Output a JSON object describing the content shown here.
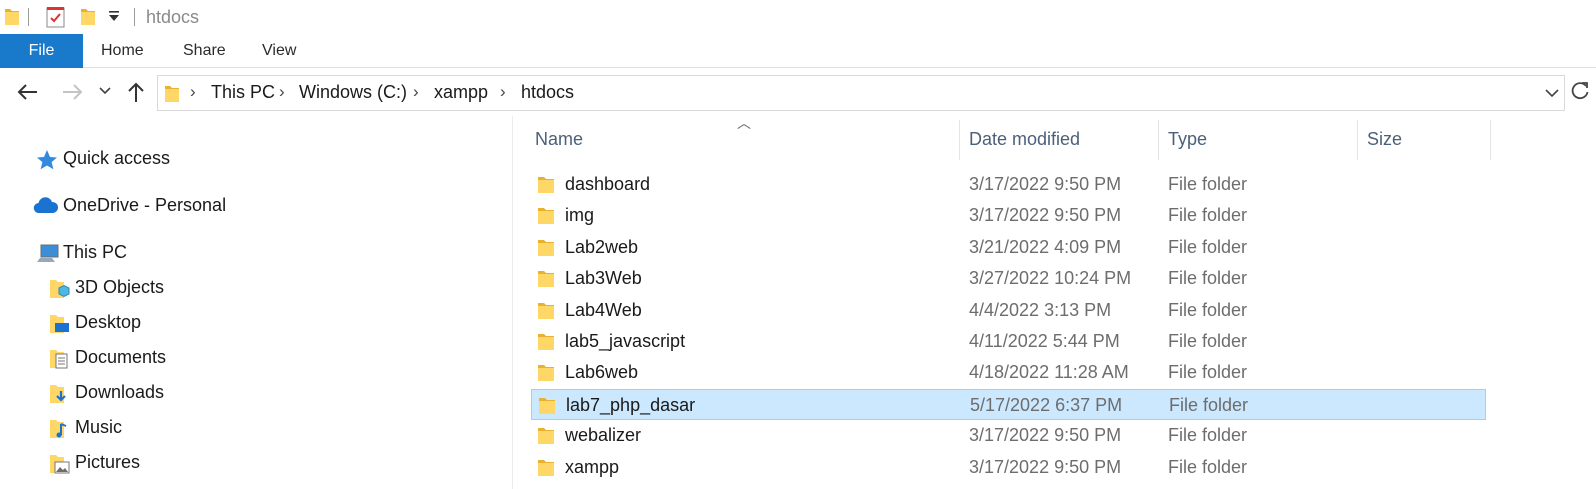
{
  "window": {
    "title": "htdocs"
  },
  "ribbon": {
    "tabs": [
      "File",
      "Home",
      "Share",
      "View"
    ]
  },
  "address": {
    "crumbs": [
      "This PC",
      "Windows (C:)",
      "xampp",
      "htdocs"
    ]
  },
  "navpane": {
    "items": [
      {
        "label": "Quick access",
        "icon": "star-icon"
      },
      {
        "label": "OneDrive - Personal",
        "icon": "cloud-icon"
      },
      {
        "label": "This PC",
        "icon": "computer-icon"
      },
      {
        "label": "3D Objects",
        "icon": "3d-objects-folder-icon"
      },
      {
        "label": "Desktop",
        "icon": "desktop-folder-icon"
      },
      {
        "label": "Documents",
        "icon": "documents-folder-icon"
      },
      {
        "label": "Downloads",
        "icon": "downloads-folder-icon"
      },
      {
        "label": "Music",
        "icon": "music-folder-icon"
      },
      {
        "label": "Pictures",
        "icon": "pictures-folder-icon"
      }
    ]
  },
  "columns": {
    "name": "Name",
    "date": "Date modified",
    "type": "Type",
    "size": "Size"
  },
  "files": [
    {
      "name": "dashboard",
      "date": "3/17/2022 9:50 PM",
      "type": "File folder"
    },
    {
      "name": "img",
      "date": "3/17/2022 9:50 PM",
      "type": "File folder"
    },
    {
      "name": "Lab2web",
      "date": "3/21/2022 4:09 PM",
      "type": "File folder"
    },
    {
      "name": "Lab3Web",
      "date": "3/27/2022 10:24 PM",
      "type": "File folder"
    },
    {
      "name": "Lab4Web",
      "date": "4/4/2022 3:13 PM",
      "type": "File folder"
    },
    {
      "name": "lab5_javascript",
      "date": "4/11/2022 5:44 PM",
      "type": "File folder"
    },
    {
      "name": "Lab6web",
      "date": "4/18/2022 11:28 AM",
      "type": "File folder"
    },
    {
      "name": "lab7_php_dasar",
      "date": "5/17/2022 6:37 PM",
      "type": "File folder",
      "selected": true
    },
    {
      "name": "webalizer",
      "date": "3/17/2022 9:50 PM",
      "type": "File folder"
    },
    {
      "name": "xampp",
      "date": "3/17/2022 9:50 PM",
      "type": "File folder"
    }
  ],
  "colors": {
    "file_tab": "#1979ca",
    "selection": "#cce8ff",
    "folder": "#ffd766"
  }
}
